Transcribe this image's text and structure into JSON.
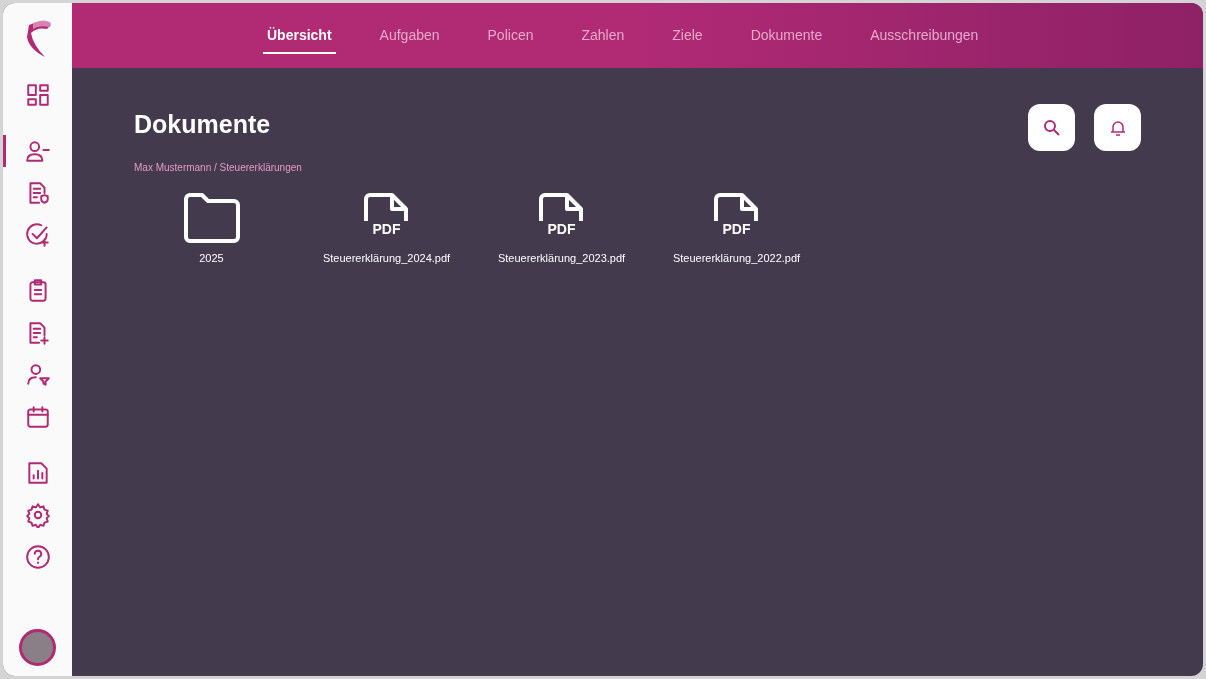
{
  "sidebar": {
    "groups": [
      [
        {
          "selected": false
        }
      ],
      [
        {
          "selected": true
        },
        {
          "selected": false
        },
        {
          "selected": false
        }
      ],
      [
        {
          "selected": false
        },
        {
          "selected": false
        },
        {
          "selected": false
        },
        {
          "selected": false
        }
      ],
      [
        {
          "selected": false
        },
        {
          "selected": false
        },
        {
          "selected": false
        }
      ]
    ]
  },
  "tabs": [
    {
      "label": "Übersicht",
      "selected": true
    },
    {
      "label": "Aufgaben",
      "selected": false
    },
    {
      "label": "Policen",
      "selected": false
    },
    {
      "label": "Zahlen",
      "selected": false
    },
    {
      "label": "Ziele",
      "selected": false
    },
    {
      "label": "Dokumente",
      "selected": false
    },
    {
      "label": "Ausschreibungen",
      "selected": false
    }
  ],
  "page_title": "Dokumente",
  "breadcrumb": "Max Mustermann / Steuererklärungen",
  "files": [
    {
      "kind": "folder",
      "name": "2025"
    },
    {
      "kind": "pdf",
      "badge": "PDF",
      "name": "Steuererklärung_2024.pdf"
    },
    {
      "kind": "pdf",
      "badge": "PDF",
      "name": "Steuererklärung_2023.pdf"
    },
    {
      "kind": "pdf",
      "badge": "PDF",
      "name": "Steuererklärung_2022.pdf"
    }
  ]
}
